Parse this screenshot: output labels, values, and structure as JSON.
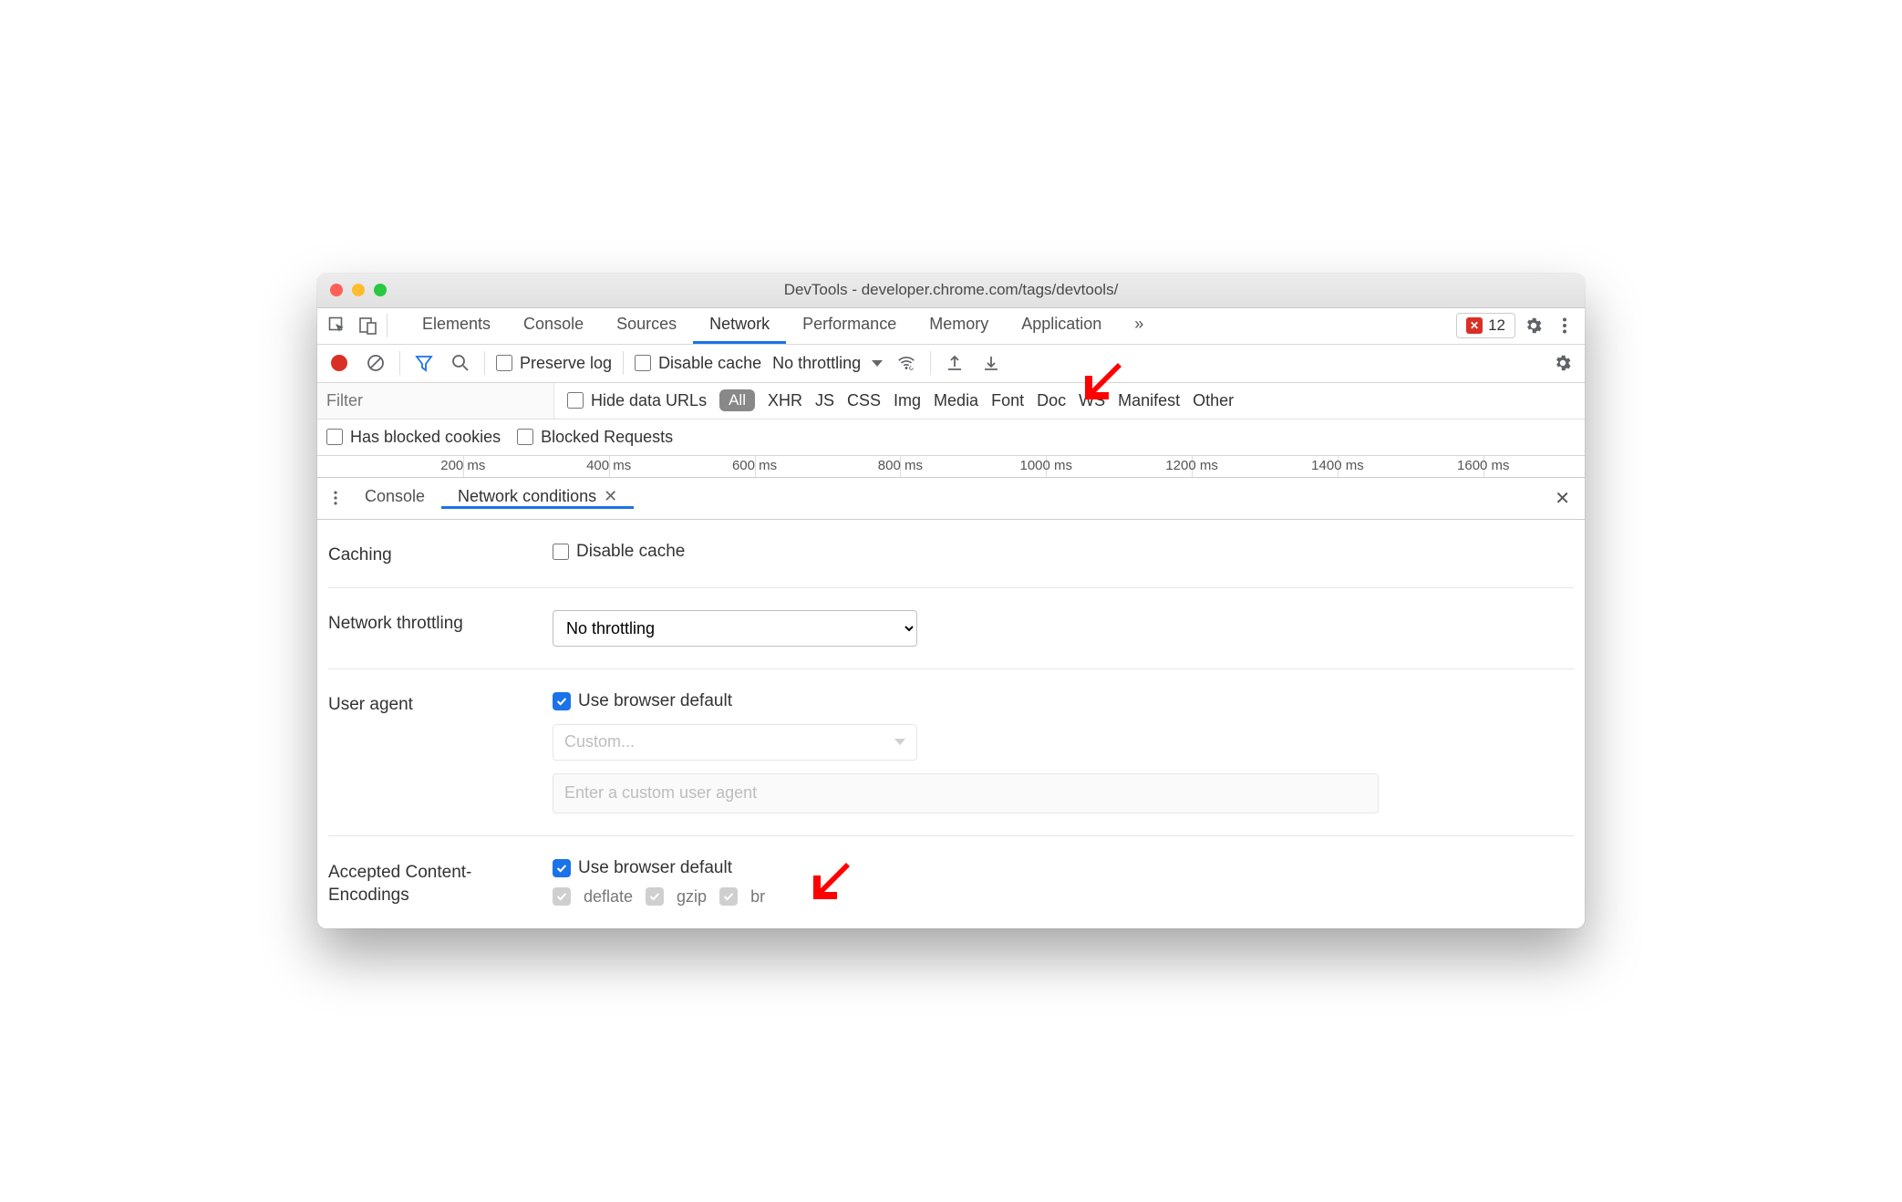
{
  "window": {
    "title": "DevTools - developer.chrome.com/tags/devtools/"
  },
  "mainTabs": [
    "Elements",
    "Console",
    "Sources",
    "Network",
    "Performance",
    "Memory",
    "Application"
  ],
  "mainTabsOverflow": "»",
  "errorCount": "12",
  "networkToolbar": {
    "preserveLog": "Preserve log",
    "disableCache": "Disable cache",
    "throttling": "No throttling"
  },
  "filter": {
    "placeholder": "Filter",
    "hideDataUrls": "Hide data URLs",
    "typeAll": "All",
    "types": [
      "XHR",
      "JS",
      "CSS",
      "Img",
      "Media",
      "Font",
      "Doc",
      "WS",
      "Manifest",
      "Other"
    ]
  },
  "row4": {
    "hasBlockedCookies": "Has blocked cookies",
    "blockedRequests": "Blocked Requests"
  },
  "timeline": [
    "200 ms",
    "400 ms",
    "600 ms",
    "800 ms",
    "1000 ms",
    "1200 ms",
    "1400 ms",
    "1600 ms"
  ],
  "drawer": {
    "tabs": {
      "console": "Console",
      "netcond": "Network conditions"
    }
  },
  "settings": {
    "caching": {
      "label": "Caching",
      "disableCache": "Disable cache"
    },
    "throttling": {
      "label": "Network throttling",
      "value": "No throttling"
    },
    "userAgent": {
      "label": "User agent",
      "useDefault": "Use browser default",
      "customPlaceholder": "Custom...",
      "enterPlaceholder": "Enter a custom user agent"
    },
    "encodings": {
      "label": "Accepted Content-Encodings",
      "useDefault": "Use browser default",
      "items": [
        "deflate",
        "gzip",
        "br"
      ]
    }
  }
}
